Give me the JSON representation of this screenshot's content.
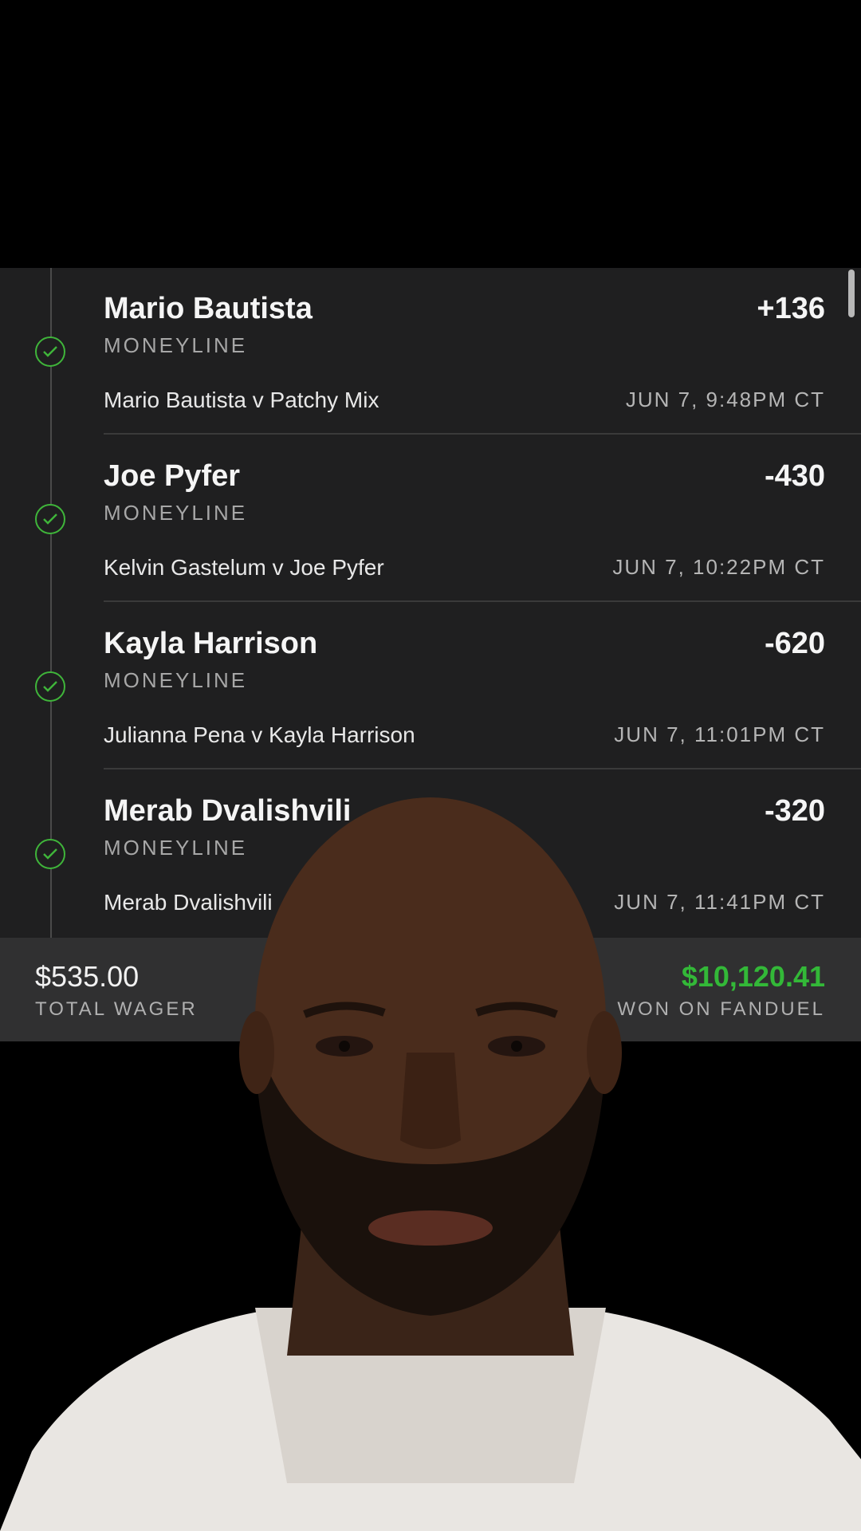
{
  "legs": [
    {
      "selection": "Mario Bautista",
      "odds": "+136",
      "market": "MONEYLINE",
      "matchup": "Mario Bautista v Patchy Mix",
      "time": "JUN 7, 9:48PM CT",
      "status": "won"
    },
    {
      "selection": "Joe Pyfer",
      "odds": "-430",
      "market": "MONEYLINE",
      "matchup": "Kelvin Gastelum v Joe Pyfer",
      "time": "JUN 7, 10:22PM CT",
      "status": "won"
    },
    {
      "selection": "Kayla Harrison",
      "odds": "-620",
      "market": "MONEYLINE",
      "matchup": "Julianna Pena v Kayla Harrison",
      "time": "JUN 7, 11:01PM CT",
      "status": "won"
    },
    {
      "selection": "Merab Dvalishvili",
      "odds": "-320",
      "market": "MONEYLINE",
      "matchup": "Merab Dvalishvili",
      "time": "JUN 7, 11:41PM CT",
      "status": "won"
    }
  ],
  "summary": {
    "total_wager": "$535.00",
    "total_wager_label": "TOTAL WAGER",
    "won_amount": "$10,120.41",
    "won_label": "WON ON FANDUEL"
  },
  "colors": {
    "background": "#000000",
    "card": "#1f1f20",
    "summary_bar": "#303031",
    "win_green": "#33b838",
    "check_green": "#3fb53a"
  },
  "icons": {
    "leg_status": "check-circle-icon"
  }
}
